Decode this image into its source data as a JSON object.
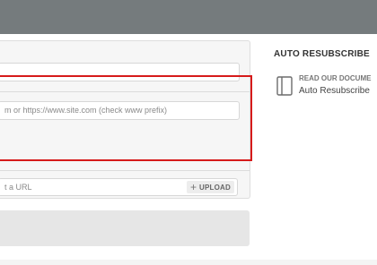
{
  "fields": {
    "url_placeholder": "m or https://www.site.com (check www prefix)",
    "upload_placeholder": "t a URL",
    "upload_label": "UPLOAD"
  },
  "sidebar": {
    "title": "AUTO RESUBSCRIBE",
    "doc_link": "READ OUR DOCUME",
    "doc_sub": "Auto Resubscribe"
  },
  "icons": {
    "upload": "plus-icon",
    "docs": "book-icon"
  },
  "colors": {
    "highlight": "#d61a1a",
    "topbar": "#757b7d"
  }
}
